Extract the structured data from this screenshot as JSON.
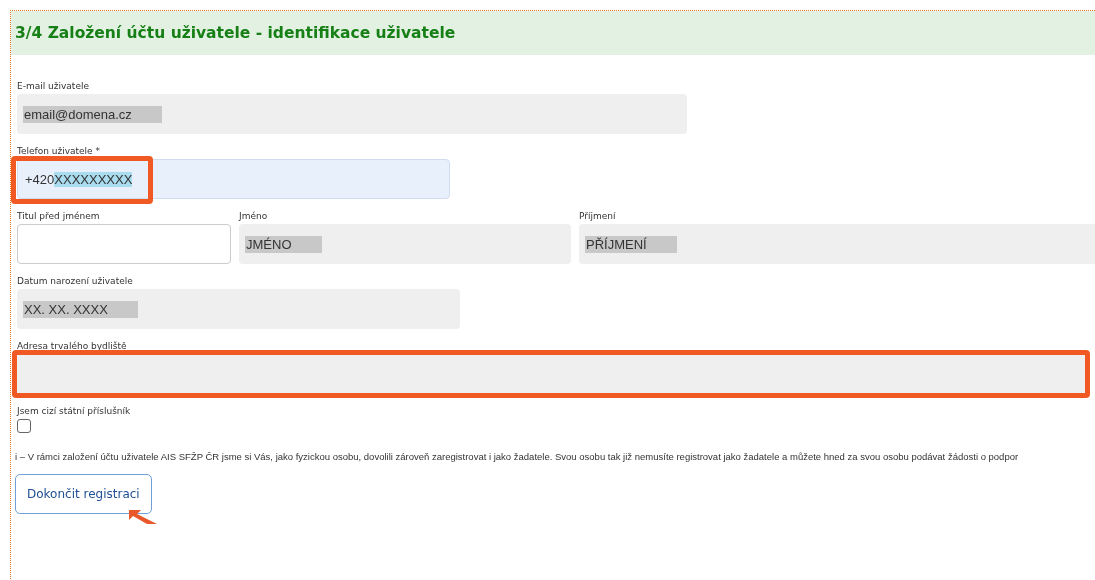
{
  "title": "3/4 Založení účtu uživatele - identifikace uživatele",
  "rows": [
    [
      {
        "kind": "readonly",
        "label": "E-mail uživatele",
        "value": "email@domena.cz",
        "redacted": true,
        "highlighted": false
      }
    ],
    [
      {
        "kind": "input",
        "label": "Telefon uživatele *",
        "value": "+420",
        "selected_text": "XXXXXXXXX",
        "focused": true,
        "highlighted": true
      }
    ],
    [
      {
        "kind": "input",
        "label": "Titul před jménem",
        "focused": false,
        "highlighted": false
      },
      {
        "kind": "readonly",
        "label": "Jméno",
        "value": "JMÉNO",
        "redacted": true,
        "highlighted": false
      },
      {
        "kind": "readonly",
        "label": "Příjmení",
        "value": "PŘÍJMENÍ",
        "redacted": true,
        "highlighted": false
      }
    ],
    [
      {
        "kind": "readonly",
        "label": "Datum narození uživatele",
        "value": "XX. XX. XXXX",
        "redacted": true,
        "highlighted": false
      }
    ],
    [
      {
        "kind": "readonly",
        "label": "Adresa trvalého bydliště",
        "highlighted": true
      }
    ],
    [
      {
        "kind": "checkbox",
        "label": "Jsem cizí státní příslušník",
        "checked": false
      }
    ]
  ],
  "info": "i – V rámci založení účtu uživatele AIS SFŽP ČR jsme si Vás, jako fyzickou osobu, dovolili zároveň zaregistrovat i jako žadatele. Svou osobu tak již nemusíte registrovat jako žadatele a můžete hned za svou osobu podávat žádosti o podpor",
  "button": "Dokončit registraci"
}
